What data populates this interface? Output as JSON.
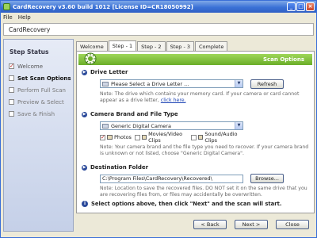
{
  "window": {
    "title": "CardRecovery v3.60 build 1012  [License ID=CR18050992]",
    "min": "_",
    "max": "□",
    "close": "×"
  },
  "menu": [
    "File",
    "Help"
  ],
  "app_header": "CardRecovery",
  "sidebar": {
    "title": "Step Status",
    "items": [
      {
        "label": "Welcome",
        "state": "done"
      },
      {
        "label": "Set Scan Options",
        "state": "active"
      },
      {
        "label": "Perform Full Scan",
        "state": "pending"
      },
      {
        "label": "Preview & Select",
        "state": "pending"
      },
      {
        "label": "Save & Finish",
        "state": "pending"
      }
    ]
  },
  "tabs": [
    "Welcome",
    "Step - 1",
    "Step - 2",
    "Step - 3",
    "Complete"
  ],
  "active_tab": 1,
  "banner": "Scan Options",
  "drive": {
    "heading": "Drive Letter",
    "select_value": "Please Select a Drive Letter ...",
    "refresh": "Refresh",
    "note": "Note: The drive which contains your memory card. If your camera or card cannot appear as a drive letter,",
    "link": "click here."
  },
  "camera": {
    "heading": "Camera Brand and File Type",
    "select_value": "Generic Digital Camera",
    "filetypes": [
      {
        "label": "Photos",
        "checked": true
      },
      {
        "label": "Movies/Video Clips",
        "checked": false
      },
      {
        "label": "Sound/Audio Clips",
        "checked": false
      }
    ],
    "note": "Note: Your camera brand and the file type you need to recover. If your camera brand is unknown or not listed, choose \"Generic Digital Camera\"."
  },
  "destination": {
    "heading": "Destination Folder",
    "value": "C:\\Program Files\\CardRecovery\\Recovered\\",
    "browse": "Browse...",
    "note": "Note: Location to save the recovered files. DO NOT set it on the same drive that you are recovering files from, or files may accidentally be overwritten."
  },
  "instruction": "Select options above, then click \"Next\" and the scan will start.",
  "footer": {
    "back": "< Back",
    "next": "Next >",
    "close": "Close"
  },
  "colors": {
    "banner": "#7ab83a",
    "titlebar": "#3b72d6"
  }
}
